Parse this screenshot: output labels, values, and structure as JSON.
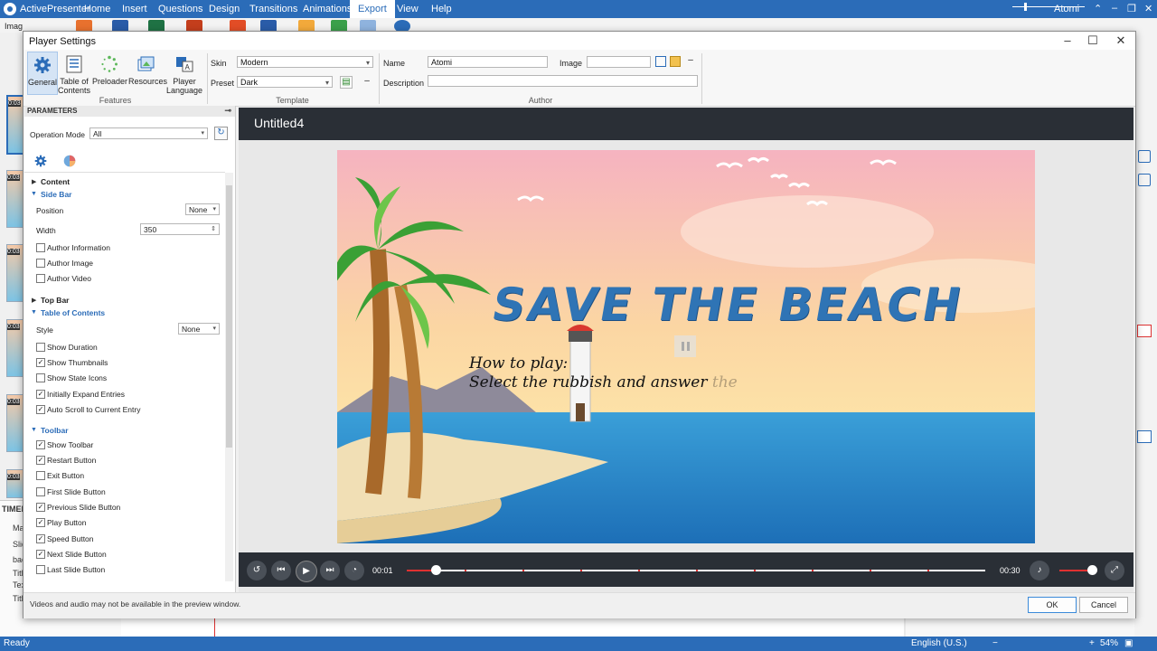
{
  "app": {
    "name": "ActivePresenter",
    "user": "Atomi",
    "tabs": [
      "Home",
      "Insert",
      "Questions",
      "Design",
      "Transitions",
      "Animations",
      "Export",
      "View",
      "Help"
    ],
    "active_tab": "Export",
    "left_tool_label": "Imag"
  },
  "status": {
    "ready": "Ready",
    "language": "English (U.S.)",
    "zoom": "54%"
  },
  "timeline": {
    "title": "TIMEL",
    "labels": [
      "Ma",
      "Slid",
      "bac",
      "Titl",
      "Tex",
      "Titl"
    ]
  },
  "slide_thumbs": [
    "0:03",
    "0:03",
    "0:03",
    "0:03",
    "0:03",
    "0:03",
    "0:03"
  ],
  "dialog": {
    "title": "Player Settings",
    "features": {
      "group_label": "Features",
      "items": [
        {
          "label_line1": "General",
          "label_line2": ""
        },
        {
          "label_line1": "Table of",
          "label_line2": "Contents"
        },
        {
          "label_line1": "Preloader",
          "label_line2": ""
        },
        {
          "label_line1": "Resources",
          "label_line2": ""
        },
        {
          "label_line1": "Player",
          "label_line2": "Language"
        }
      ]
    },
    "template": {
      "group_label": "Template",
      "skin_label": "Skin",
      "skin_value": "Modern",
      "preset_label": "Preset",
      "preset_value": "Dark"
    },
    "author": {
      "group_label": "Author",
      "name_label": "Name",
      "name_value": "Atomi",
      "image_label": "Image",
      "image_value": "",
      "description_label": "Description",
      "description_value": ""
    },
    "parameters": {
      "header": "PARAMETERS",
      "operation_mode_label": "Operation Mode",
      "operation_mode_value": "All",
      "content_section": "Content",
      "side_bar": {
        "title": "Side Bar",
        "position_label": "Position",
        "position_value": "None",
        "width_label": "Width",
        "width_value": "350",
        "checks": [
          {
            "label": "Author Information",
            "checked": false
          },
          {
            "label": "Author Image",
            "checked": false
          },
          {
            "label": "Author Video",
            "checked": false
          }
        ]
      },
      "top_bar_section": "Top Bar",
      "toc": {
        "title": "Table of Contents",
        "style_label": "Style",
        "style_value": "None",
        "checks": [
          {
            "label": "Show Duration",
            "checked": false
          },
          {
            "label": "Show Thumbnails",
            "checked": true
          },
          {
            "label": "Show State Icons",
            "checked": false
          },
          {
            "label": "Initially Expand Entries",
            "checked": true
          },
          {
            "label": "Auto Scroll to Current Entry",
            "checked": true
          }
        ]
      },
      "toolbar": {
        "title": "Toolbar",
        "checks": [
          {
            "label": "Show Toolbar",
            "checked": true
          },
          {
            "label": "Restart Button",
            "checked": true
          },
          {
            "label": "Exit Button",
            "checked": false
          },
          {
            "label": "First Slide Button",
            "checked": false
          },
          {
            "label": "Previous Slide Button",
            "checked": true
          },
          {
            "label": "Play Button",
            "checked": true
          },
          {
            "label": "Speed Button",
            "checked": true
          },
          {
            "label": "Next Slide Button",
            "checked": true
          },
          {
            "label": "Last Slide Button",
            "checked": false
          }
        ]
      }
    },
    "preview": {
      "title": "Untitled4",
      "slide_heading": "SAVE THE BEACH",
      "slide_line1": "How to play:",
      "slide_line2": "Select the rubbish and answer",
      "slide_line2_fade": "the",
      "time_current": "00:01",
      "time_total": "00:30",
      "progress": 0.05,
      "volume": 0.85
    },
    "footer_note": "Videos and audio may not be available in the preview window.",
    "ok_label": "OK",
    "cancel_label": "Cancel"
  },
  "colors": {
    "accent": "#2b6cb8",
    "player_bar": "#2a2f36",
    "progress": "#e03131"
  }
}
